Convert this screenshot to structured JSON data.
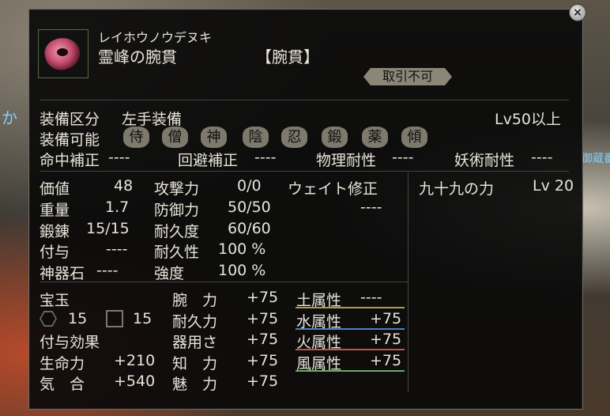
{
  "background": {
    "left_text": "か",
    "right_text": "御蔵番"
  },
  "item": {
    "reading": "レイホウノウデヌキ",
    "name": "霊峰の腕貫",
    "type": "【腕貫】",
    "trade_label": "取引不可"
  },
  "equip": {
    "slot_label": "装備区分",
    "slot_value": "左手装備",
    "level_req": "Lv50以上",
    "usable_label": "装備可能",
    "classes": [
      "侍",
      "僧",
      "神",
      "陰",
      "忍",
      "鍛",
      "薬",
      "傾"
    ]
  },
  "corrections": [
    {
      "label": "命中補正",
      "value": "----"
    },
    {
      "label": "回避補正",
      "value": "----"
    },
    {
      "label": "物理耐性",
      "value": "----"
    },
    {
      "label": "妖術耐性",
      "value": "----"
    }
  ],
  "stats_left": [
    {
      "label": "価値",
      "value": "48"
    },
    {
      "label": "重量",
      "value": "1.7"
    },
    {
      "label": "鍛錬",
      "value": "15/15"
    },
    {
      "label": "付与",
      "value": "----"
    },
    {
      "label": "神器石",
      "value": "----"
    }
  ],
  "stats_mid": [
    {
      "label": "攻撃力",
      "value": "0/0"
    },
    {
      "label": "防御力",
      "value": "50/50"
    },
    {
      "label": "耐久度",
      "value": "60/60"
    },
    {
      "label": "耐久性",
      "value": "100 %"
    },
    {
      "label": "強度",
      "value": "100 %"
    }
  ],
  "weight_fix": {
    "label": "ウェイト修正",
    "value": "----"
  },
  "skill": {
    "label": "九十九の力",
    "value": "Lv 20"
  },
  "gems": {
    "label": "宝玉",
    "hex_count": "15",
    "square_count": "15"
  },
  "effects_label": "付与効果",
  "effects_left": [
    {
      "label": "生命力",
      "value": "+210"
    },
    {
      "label": "気　合",
      "value": "+540"
    }
  ],
  "attrs_mid": [
    {
      "label": "腕　力",
      "value": "+75"
    },
    {
      "label": "耐久力",
      "value": "+75"
    },
    {
      "label": "器用さ",
      "value": "+75"
    },
    {
      "label": "知　力",
      "value": "+75"
    },
    {
      "label": "魅　力",
      "value": "+75"
    }
  ],
  "elements": [
    {
      "label": "土属性",
      "value": "----",
      "color": "#b89a3e"
    },
    {
      "label": "水属性",
      "value": "+75",
      "color": "#4f7fbf"
    },
    {
      "label": "火属性",
      "value": "+75",
      "color": "#b55a4a"
    },
    {
      "label": "風属性",
      "value": "+75",
      "color": "#6fa86a"
    }
  ]
}
